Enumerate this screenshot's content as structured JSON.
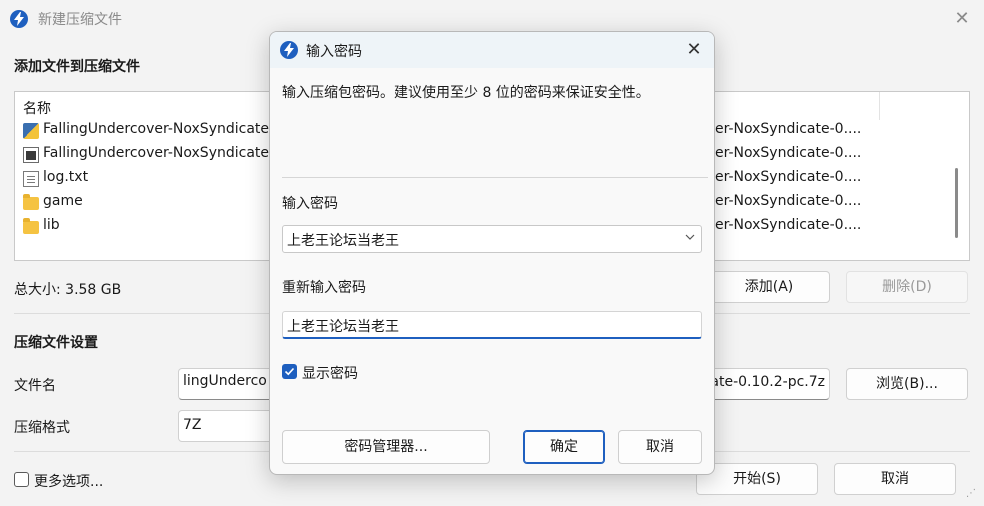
{
  "main": {
    "title": "新建压缩文件",
    "add_section_title": "添加文件到压缩文件",
    "list_header_name": "名称",
    "files": [
      {
        "name": "FallingUndercover-NoxSyndicate",
        "path": "er-NoxSyndicate-0....",
        "icon": "python-file-icon"
      },
      {
        "name": "FallingUndercover-NoxSyndicate",
        "path": "er-NoxSyndicate-0....",
        "icon": "executable-file-icon"
      },
      {
        "name": "log.txt",
        "path": "er-NoxSyndicate-0....",
        "icon": "text-file-icon"
      },
      {
        "name": "game",
        "path": "er-NoxSyndicate-0....",
        "icon": "folder-icon"
      },
      {
        "name": "lib",
        "path": "er-NoxSyndicate-0....",
        "icon": "folder-icon"
      }
    ],
    "total_size": "总大小: 3.58 GB",
    "add_button": "添加(A)",
    "delete_button": "删除(D)",
    "settings_section_title": "压缩文件设置",
    "filename_label": "文件名",
    "filename_value_left": "lingUnderco",
    "filename_value_right": "ate-0.10.2-pc.7z",
    "browse_button": "浏览(B)...",
    "format_label": "压缩格式",
    "format_value": "7Z",
    "more_options_label": "更多选项...",
    "start_button": "开始(S)",
    "cancel_button": "取消"
  },
  "dialog": {
    "title": "输入密码",
    "description": "输入压缩包密码。建议使用至少 8 位的密码来保证安全性。",
    "password_label": "输入密码",
    "password_value": "上老王论坛当老王",
    "confirm_label": "重新输入密码",
    "confirm_value": "上老王论坛当老王",
    "show_password_label": "显示密码",
    "show_password_checked": true,
    "manager_button": "密码管理器...",
    "ok_button": "确定",
    "cancel_button": "取消"
  },
  "colors": {
    "accent": "#1e5fbf",
    "window_bg": "#f3f3f3",
    "dialog_title_bg": "#eef4f8"
  }
}
